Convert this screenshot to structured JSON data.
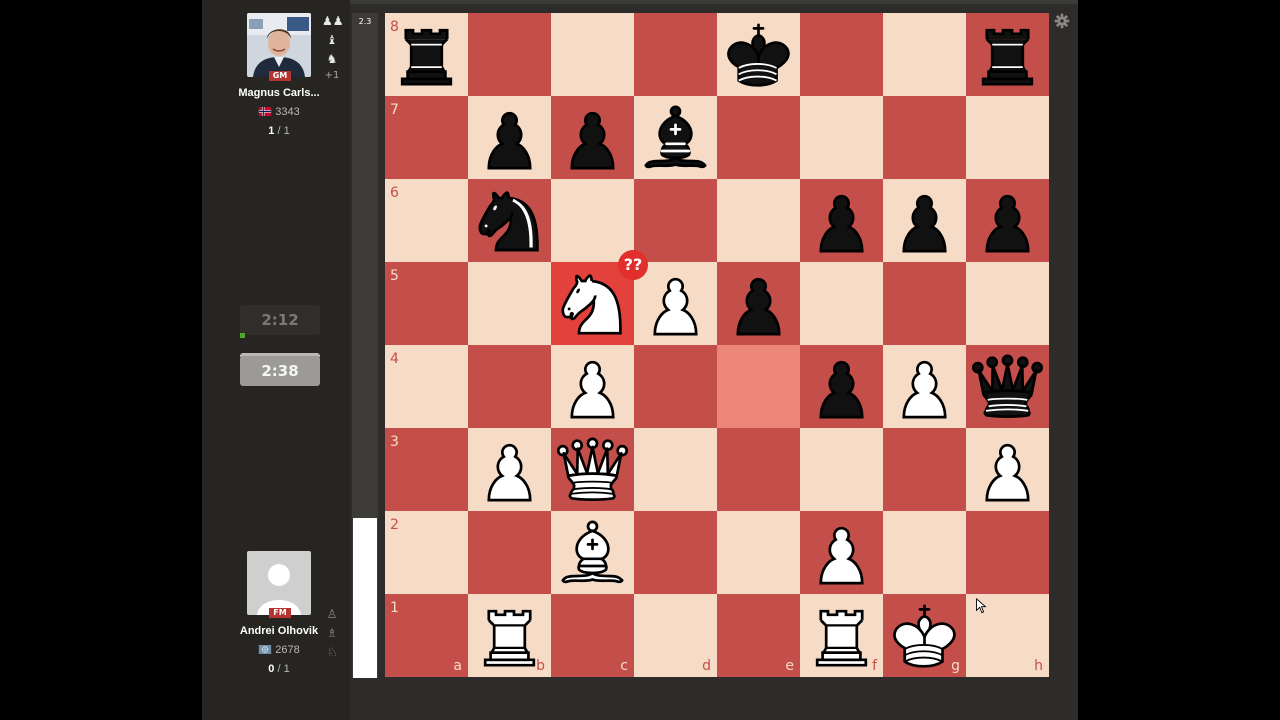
{
  "top_player": {
    "name": "Magnus Carls...",
    "title": "GM",
    "rating": "3343",
    "score_won": "1",
    "score_total": "1",
    "clock": "2:12",
    "captures": {
      "pieces": [
        "pawn-pair-icon",
        "bishop-icon",
        "knight-icon"
      ],
      "extra": "+1"
    }
  },
  "bottom_player": {
    "name": "Andrei Olhovik",
    "title": "FM",
    "rating": "2678",
    "score_won": "0",
    "score_total": "1",
    "clock": "2:38",
    "captures": {
      "pieces": [
        "pawn-icon",
        "bishop-icon",
        "knight-icon"
      ]
    }
  },
  "score_sep": " / ",
  "eval": {
    "score": "2.3",
    "white_fraction": 0.24
  },
  "board": {
    "files": [
      "a",
      "b",
      "c",
      "d",
      "e",
      "f",
      "g",
      "h"
    ],
    "ranks": [
      "8",
      "7",
      "6",
      "5",
      "4",
      "3",
      "2",
      "1"
    ],
    "fen": "r3k2r/1ppb4/1n3ppp/2NPp3/2P2pPq/1PQ4P/2B2P2/1R3RK1",
    "last_move_from": "c5",
    "last_move_to": "e4",
    "annotation": {
      "square": "c5",
      "label": "??"
    }
  },
  "colors": {
    "light_square": "#f6dcc7",
    "dark_square": "#c44e4a",
    "highlight_from": "#e2423b",
    "highlight_to": "#ec8678",
    "blunder_badge": "#e12f2c",
    "white_piece": "#ffffff",
    "black_piece": "#111111"
  }
}
